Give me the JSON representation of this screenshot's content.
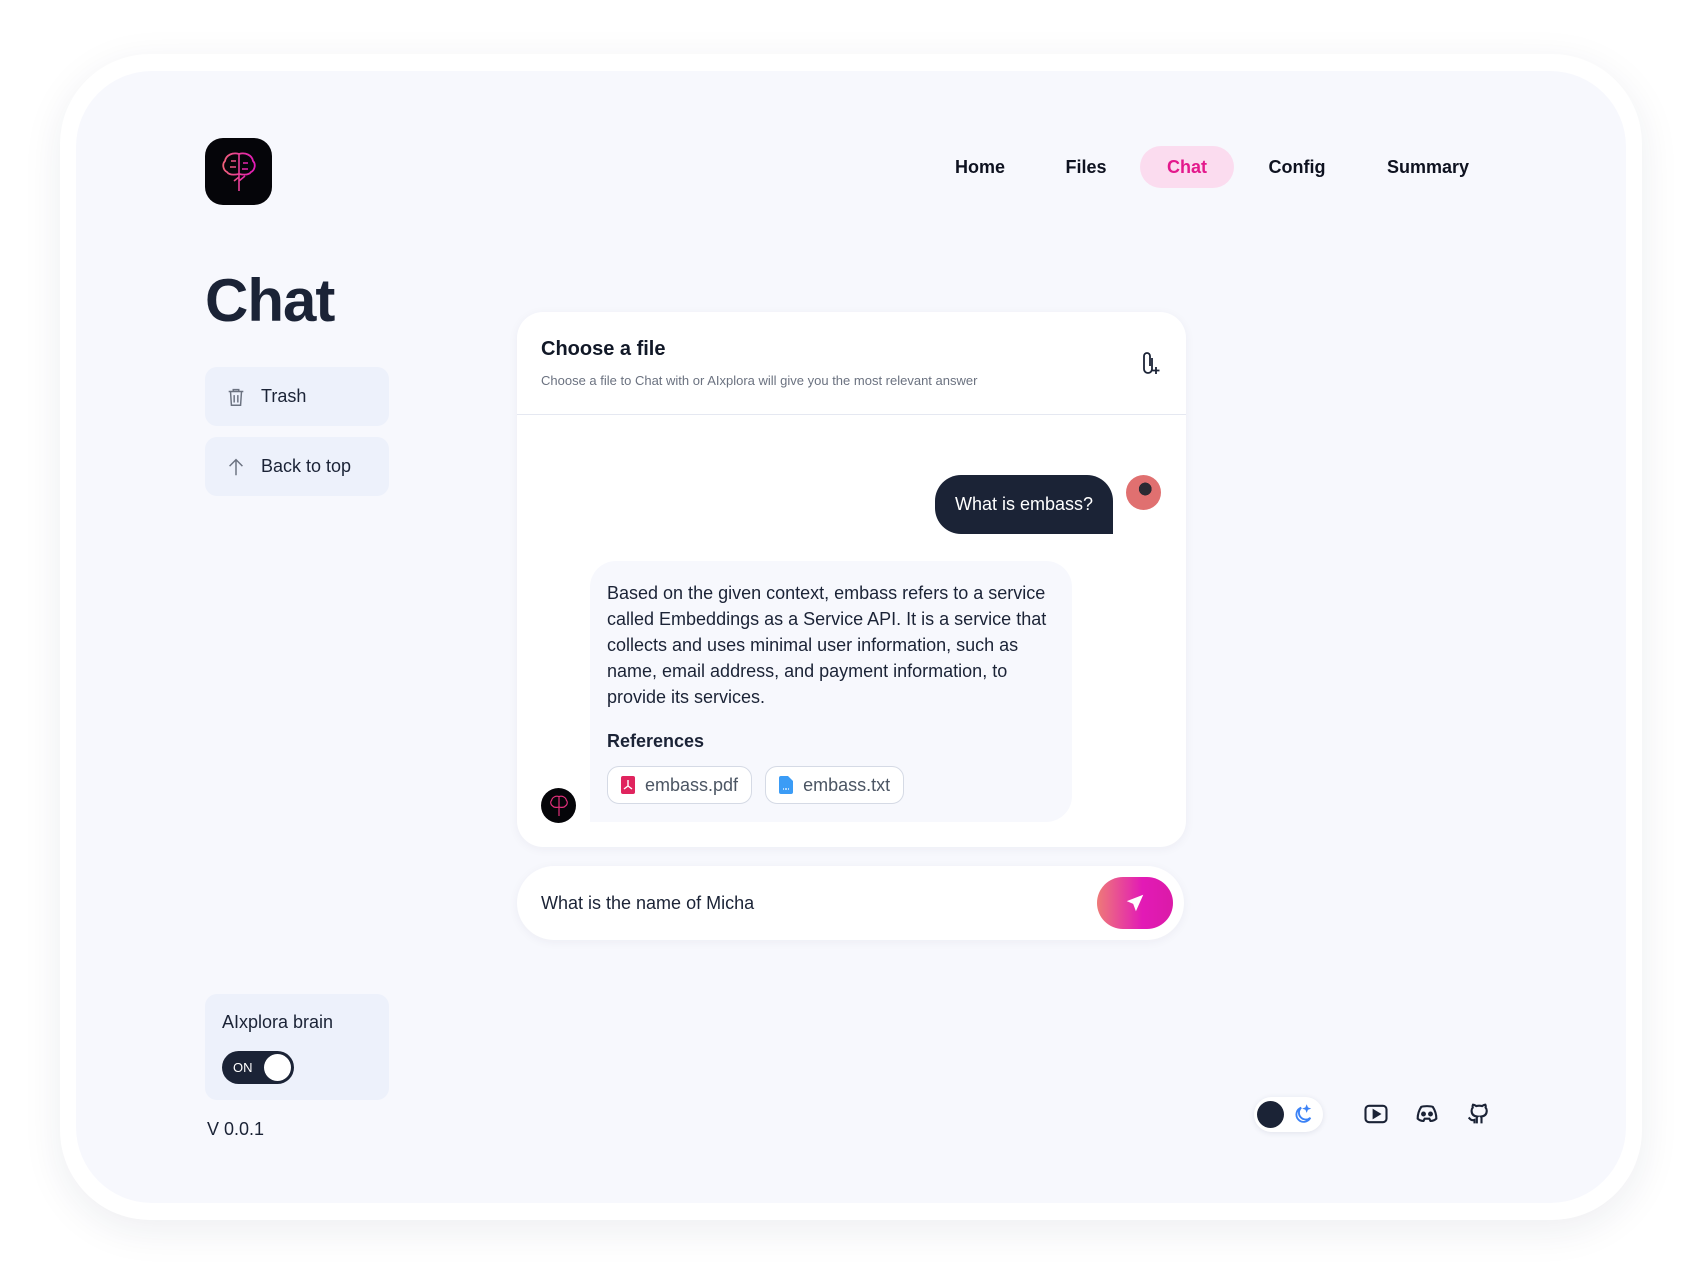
{
  "nav": {
    "items": [
      {
        "label": "Home"
      },
      {
        "label": "Files"
      },
      {
        "label": "Chat",
        "active": true
      },
      {
        "label": "Config"
      },
      {
        "label": "Summary"
      }
    ]
  },
  "page_title": "Chat",
  "sidebar": {
    "trash_label": "Trash",
    "back_to_top_label": "Back to top"
  },
  "file_picker": {
    "title": "Choose a file",
    "subtitle": "Choose a file to Chat with or AIxplora will give you the most relevant answer",
    "icon": "paperclip-plus-icon"
  },
  "messages": [
    {
      "role": "user",
      "text": "What is embass?"
    },
    {
      "role": "assistant",
      "text": "Based on the given context, embass refers to a service called Embeddings as a Service API. It is a service that collects and uses minimal user information, such as name, email address, and payment information, to provide its services.",
      "references_label": "References",
      "references": [
        {
          "name": "embass.pdf",
          "icon": "pdf-file-icon"
        },
        {
          "name": "embass.txt",
          "icon": "text-file-icon"
        }
      ]
    }
  ],
  "input": {
    "value": "What is the name of Micha"
  },
  "brain": {
    "label": "AIxplora brain",
    "toggle_label": "ON",
    "enabled": true
  },
  "version": "V 0.0.1",
  "footer_icons": [
    "moon-icon",
    "youtube-icon",
    "discord-icon",
    "github-icon"
  ],
  "colors": {
    "accent": "#e3198c",
    "dark": "#1b2336",
    "background": "#f7f8fd"
  }
}
